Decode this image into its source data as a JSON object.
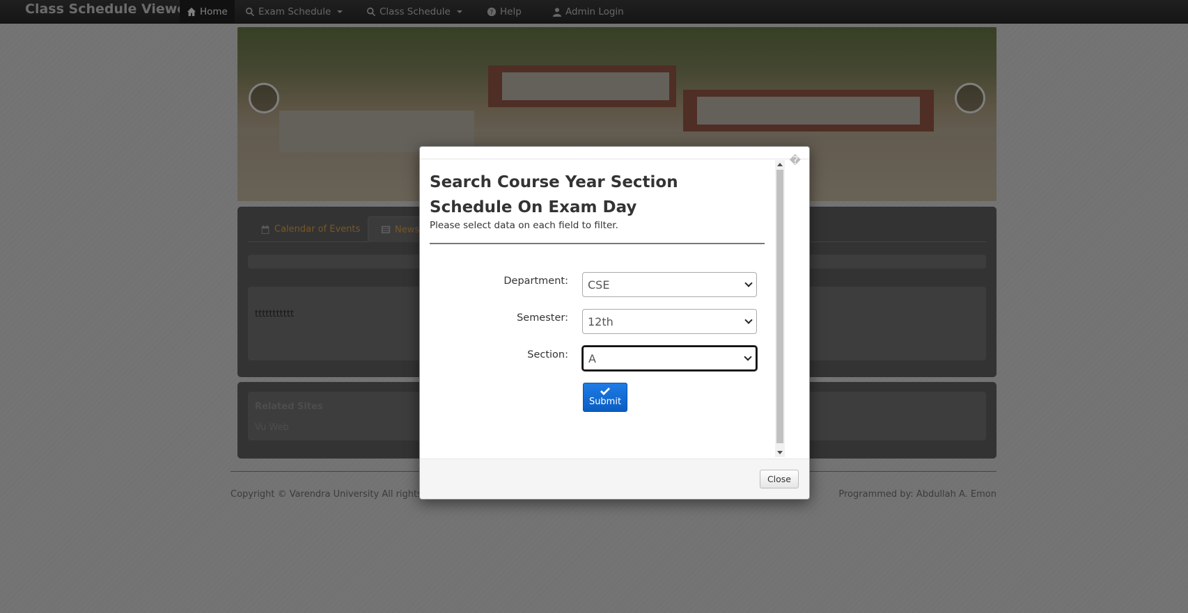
{
  "navbar": {
    "brand": "Class Schedule Viewer",
    "items": [
      {
        "label": "Home",
        "icon": "home-icon"
      },
      {
        "label": "Exam Schedule",
        "icon": "search-icon"
      },
      {
        "label": "Class Schedule",
        "icon": "search-icon"
      },
      {
        "label": "Help",
        "icon": "question-circle-icon"
      },
      {
        "label": "Admin Login",
        "icon": "user-icon"
      }
    ]
  },
  "tabs": [
    {
      "label": "Calendar of Events",
      "icon": "calendar-icon"
    },
    {
      "label": "News",
      "icon": "list-icon"
    }
  ],
  "news": {
    "text": "ttttttttttt"
  },
  "related": {
    "title": "Related Sites",
    "link": "Vu Web"
  },
  "footer": {
    "copyright": "Copyright © Varendra University All rights r",
    "programmer": "Programmed by: Abdullah A. Emon"
  },
  "modal": {
    "close_x": "�",
    "title": "Search Course Year Section Schedule On Exam Day",
    "subtitle": "Please select data on each field to filter.",
    "fields": {
      "department": {
        "label": "Department:",
        "value": "CSE"
      },
      "semester": {
        "label": "Semester:",
        "value": "12th"
      },
      "section": {
        "label": "Section:",
        "value": "A"
      }
    },
    "submit_label": "Submit",
    "close_label": "Close"
  },
  "colors": {
    "accent": "#0a5ec2",
    "tab_text": "#f0ad4e",
    "navbar": "#333333"
  }
}
